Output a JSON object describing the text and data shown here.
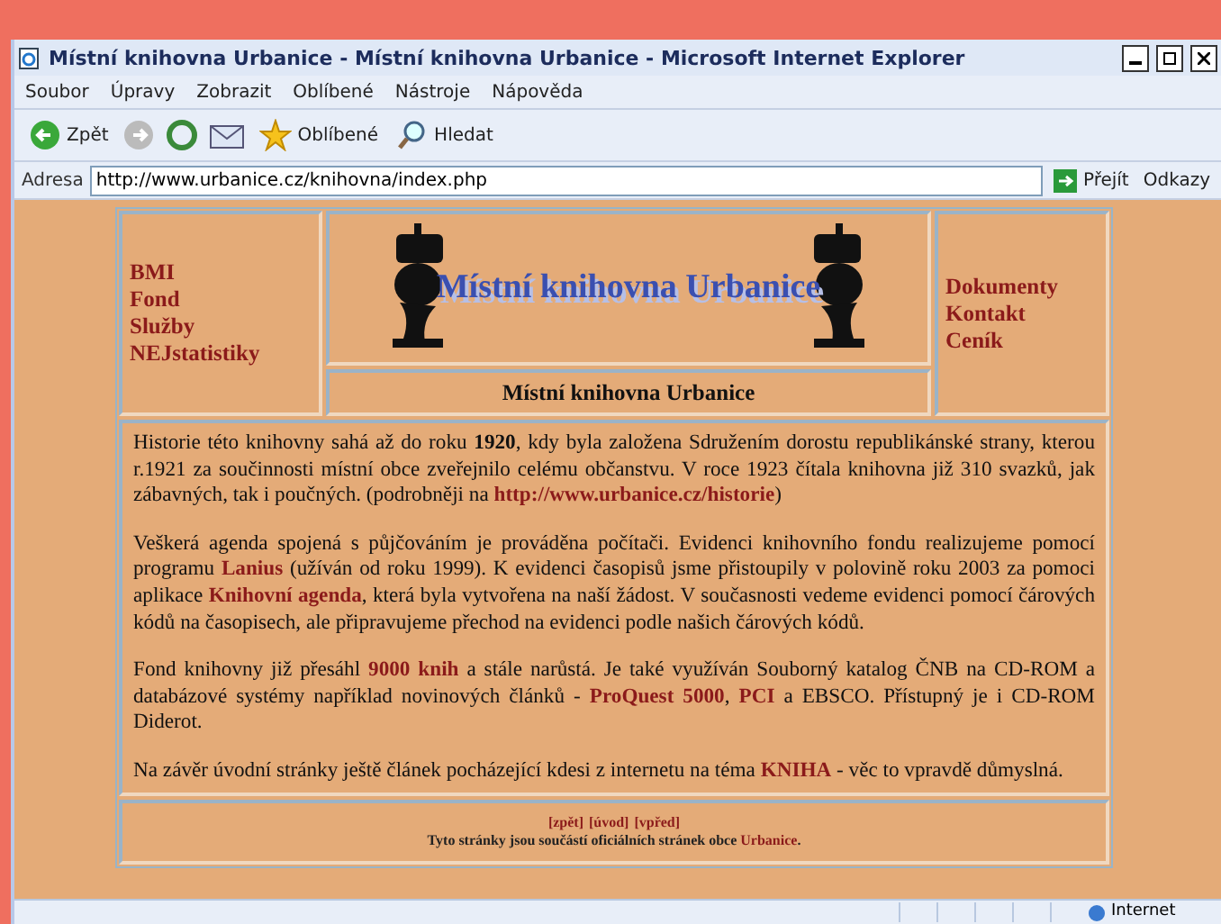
{
  "window": {
    "title": "Místní knihovna Urbanice - Místní knihovna Urbanice - Microsoft Internet Explorer"
  },
  "menu": [
    "Soubor",
    "Úpravy",
    "Zobrazit",
    "Oblíbené",
    "Nástroje",
    "Nápověda"
  ],
  "toolbar": {
    "back": "Zpět",
    "favorites": "Oblíbené",
    "search": "Hledat"
  },
  "address": {
    "label": "Adresa",
    "value": "http://www.urbanice.cz/knihovna/index.php",
    "go": "Přejít",
    "links": "Odkazy"
  },
  "page": {
    "left_nav": [
      "BMI",
      "Fond",
      "Služby",
      "NEJstatistiky"
    ],
    "logo_text": "Místní knihovna Urbanice",
    "heading": "Místní knihovna Urbanice",
    "right_nav": [
      "Dokumenty",
      "Kontakt",
      "Ceník"
    ],
    "paragraphs": [
      [
        {
          "kind": "plain",
          "text": "Historie této knihovny sahá až do roku "
        },
        {
          "kind": "bold",
          "text": "1920"
        },
        {
          "kind": "plain",
          "text": ", kdy byla založena Sdružením dorostu republikánské strany, kterou r.1921 za součinnosti místní obce zveřejnilo celému občanstvu. V roce 1923 čítala knihovna již 310 svazků, jak zábavných, tak i poučných. (podrobněji na "
        },
        {
          "kind": "link",
          "text": "http://www.urbanice.cz/historie"
        },
        {
          "kind": "plain",
          "text": ")"
        }
      ],
      [
        {
          "kind": "plain",
          "text": "Veškerá agenda spojená s půjčováním je prováděna počítači. Evidenci knihovního fondu realizujeme pomocí programu "
        },
        {
          "kind": "link",
          "text": "Lanius"
        },
        {
          "kind": "plain",
          "text": " (užíván od roku 1999). K evidenci časopisů jsme přistoupily v polovině roku 2003 za pomoci aplikace "
        },
        {
          "kind": "link",
          "text": "Knihovní agenda"
        },
        {
          "kind": "plain",
          "text": ", která byla vytvořena na naší žádost. V současnosti vedeme evidenci pomocí čárových kódů na časopisech, ale připravujeme přechod na evidenci podle našich čárových kódů."
        }
      ],
      [
        {
          "kind": "plain",
          "text": "Fond knihovny již přesáhl "
        },
        {
          "kind": "link",
          "text": "9000 knih"
        },
        {
          "kind": "plain",
          "text": " a stále narůstá. Je také využíván Souborný katalog ČNB na CD-ROM a databázové systémy například novinových článků - "
        },
        {
          "kind": "link",
          "text": "ProQuest 5000"
        },
        {
          "kind": "plain",
          "text": ", "
        },
        {
          "kind": "link",
          "text": "PCI"
        },
        {
          "kind": "plain",
          "text": " a EBSCO. Přístupný je i CD-ROM Diderot."
        }
      ],
      [
        {
          "kind": "plain",
          "text": "Na závěr úvodní stránky ještě článek pocházející kdesi z internetu na téma "
        },
        {
          "kind": "link",
          "text": "KNIHA"
        },
        {
          "kind": "plain",
          "text": " - věc to vpravdě důmyslná."
        }
      ]
    ],
    "footer_links": [
      "[zpět]",
      "[úvod]",
      "[vpřed]"
    ],
    "footer_note": [
      {
        "kind": "plain",
        "text": "Tyto stránky jsou součástí oficiálních stránek obce "
      },
      {
        "kind": "link",
        "text": "Urbanice"
      },
      {
        "kind": "plain",
        "text": "."
      }
    ]
  },
  "status_bar": {
    "zone": "Internet"
  }
}
